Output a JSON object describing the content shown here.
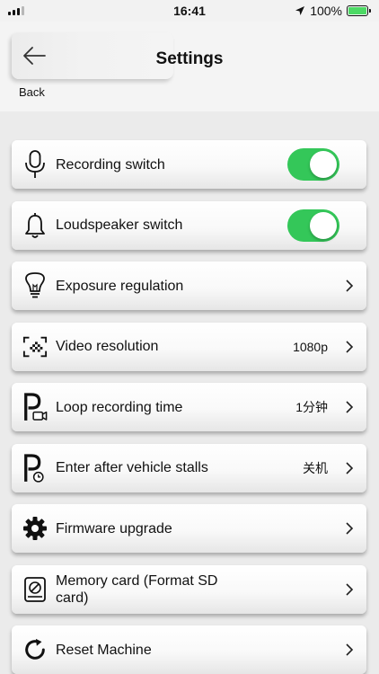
{
  "status_bar": {
    "time": "16:41",
    "battery_percent": "100%",
    "icons": [
      "signal-icon",
      "location-arrow-icon",
      "battery-charging-icon"
    ]
  },
  "header": {
    "title": "Settings",
    "back_label": "Back"
  },
  "colors": {
    "toggle_on": "#34c759",
    "battery": "#4cd964"
  },
  "settings": [
    {
      "label": "Recording switch",
      "icon": "microphone-icon",
      "control": "toggle",
      "on": true
    },
    {
      "label": "Loudspeaker switch",
      "icon": "bell-icon",
      "control": "toggle",
      "on": true
    },
    {
      "label": "Exposure regulation",
      "icon": "lightbulb-icon",
      "control": "chevron"
    },
    {
      "label": "Video resolution",
      "icon": "resolution-frame-icon",
      "control": "chevron",
      "value": "1080p"
    },
    {
      "label": "Loop recording time",
      "icon": "parking-camera-icon",
      "control": "chevron",
      "value": "1分钟"
    },
    {
      "label": "Enter after vehicle stalls",
      "icon": "parking-clock-icon",
      "control": "chevron",
      "value": "关机"
    },
    {
      "label": "Firmware upgrade",
      "icon": "gear-icon",
      "control": "chevron"
    },
    {
      "label": "Memory card (Format SD card)",
      "icon": "sd-card-icon",
      "control": "chevron"
    },
    {
      "label": "Reset Machine",
      "icon": "reset-icon",
      "control": "chevron"
    }
  ]
}
